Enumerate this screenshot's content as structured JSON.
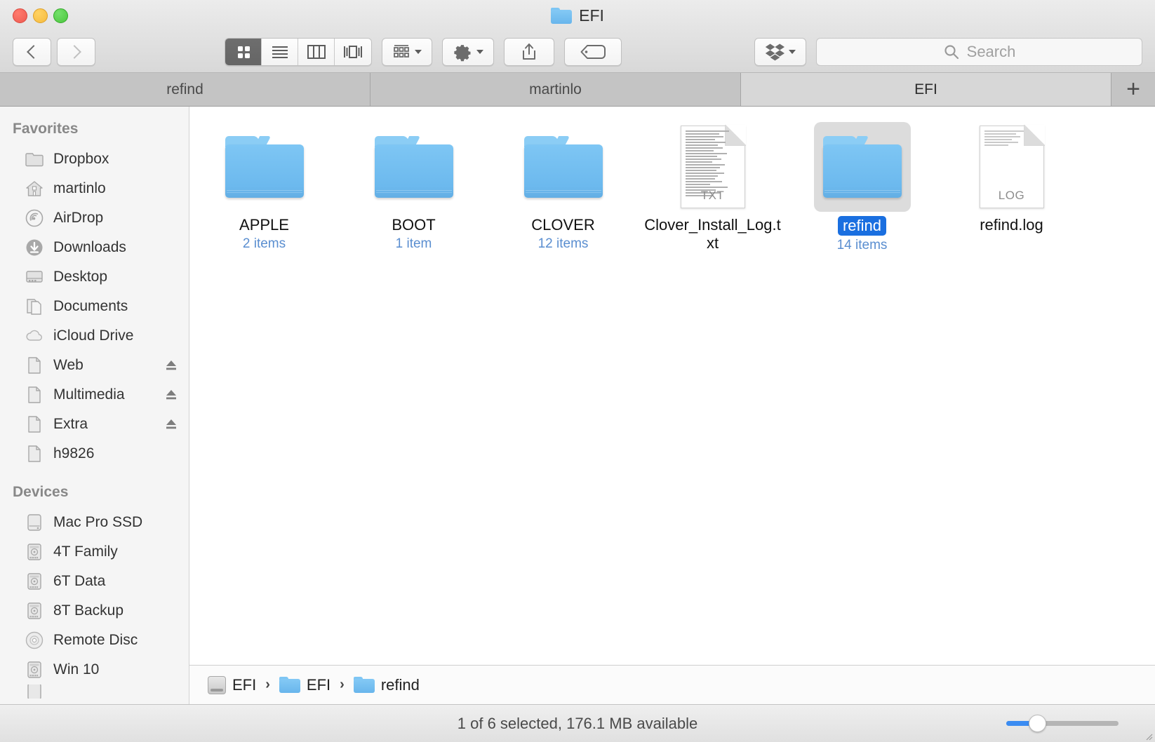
{
  "window": {
    "title": "EFI",
    "title_icon": "folder-icon",
    "traffic_lights": [
      {
        "name": "close-button",
        "color": "#ee5b51"
      },
      {
        "name": "minimize-button",
        "color": "#f6bb3f"
      },
      {
        "name": "zoom-button",
        "color": "#4cc63e"
      }
    ]
  },
  "toolbar": {
    "back_label": "back-icon",
    "forward_label": "forward-icon",
    "view_modes": [
      {
        "name": "icon-view",
        "icon": "grid-icon",
        "active": true
      },
      {
        "name": "list-view",
        "icon": "list-icon",
        "active": false
      },
      {
        "name": "column-view",
        "icon": "columns-icon",
        "active": false
      },
      {
        "name": "gallery-view",
        "icon": "gallery-icon",
        "active": false
      }
    ],
    "arrange": {
      "name": "arrange-button",
      "icon": "arrange-icon"
    },
    "action": {
      "name": "action-button",
      "icon": "gear-icon"
    },
    "share": {
      "name": "share-button",
      "icon": "share-icon"
    },
    "tags": {
      "name": "tags-button",
      "icon": "tag-icon"
    },
    "dropbox": {
      "name": "dropbox-button",
      "icon": "dropbox-icon"
    },
    "search": {
      "placeholder": "Search",
      "value": "",
      "icon": "search-icon"
    }
  },
  "tabs": {
    "items": [
      {
        "label": "refind",
        "active": false
      },
      {
        "label": "martinlo",
        "active": false
      },
      {
        "label": "EFI",
        "active": true
      }
    ],
    "add_label": "+"
  },
  "sidebar": {
    "sections": [
      {
        "title": "Favorites",
        "items": [
          {
            "label": "Dropbox",
            "icon": "folder-icon",
            "eject": false
          },
          {
            "label": "martinlo",
            "icon": "home-icon",
            "eject": false
          },
          {
            "label": "AirDrop",
            "icon": "airdrop-icon",
            "eject": false
          },
          {
            "label": "Downloads",
            "icon": "downloads-icon",
            "eject": false
          },
          {
            "label": "Desktop",
            "icon": "desktop-icon",
            "eject": false
          },
          {
            "label": "Documents",
            "icon": "documents-icon",
            "eject": false
          },
          {
            "label": "iCloud Drive",
            "icon": "cloud-icon",
            "eject": false
          },
          {
            "label": "Web",
            "icon": "document-icon",
            "eject": true
          },
          {
            "label": "Multimedia",
            "icon": "document-icon",
            "eject": true
          },
          {
            "label": "Extra",
            "icon": "document-icon",
            "eject": true
          },
          {
            "label": "h9826",
            "icon": "document-icon",
            "eject": false
          }
        ]
      },
      {
        "title": "Devices",
        "items": [
          {
            "label": "Mac Pro SSD",
            "icon": "internal-drive-icon",
            "eject": false
          },
          {
            "label": "4T Family",
            "icon": "external-drive-icon",
            "eject": false
          },
          {
            "label": "6T Data",
            "icon": "external-drive-icon",
            "eject": false
          },
          {
            "label": "8T Backup",
            "icon": "external-drive-icon",
            "eject": false
          },
          {
            "label": "Remote Disc",
            "icon": "optical-disc-icon",
            "eject": false
          },
          {
            "label": "Win 10",
            "icon": "external-drive-icon",
            "eject": false
          }
        ]
      }
    ]
  },
  "files": [
    {
      "name": "APPLE",
      "subtitle": "2 items",
      "kind": "folder",
      "selected": false
    },
    {
      "name": "BOOT",
      "subtitle": "1 item",
      "kind": "folder",
      "selected": false
    },
    {
      "name": "CLOVER",
      "subtitle": "12 items",
      "kind": "folder",
      "selected": false
    },
    {
      "name": "Clover_Install_Log.txt",
      "subtitle": "",
      "kind": "document",
      "ext": "TXT",
      "selected": false
    },
    {
      "name": "refind",
      "subtitle": "14 items",
      "kind": "folder",
      "selected": true
    },
    {
      "name": "refind.log",
      "subtitle": "",
      "kind": "document",
      "ext": "LOG",
      "selected": false
    }
  ],
  "pathbar": {
    "segments": [
      {
        "label": "EFI",
        "icon": "drive-icon"
      },
      {
        "label": "EFI",
        "icon": "folder-icon"
      },
      {
        "label": "refind",
        "icon": "folder-icon"
      }
    ],
    "separator": "›"
  },
  "statusbar": {
    "text": "1 of 6 selected, 176.1 MB available",
    "zoom_slider": {
      "name": "icon-size-slider",
      "value": 22,
      "min": 0,
      "max": 100,
      "accent": "#3b8cf2"
    }
  }
}
